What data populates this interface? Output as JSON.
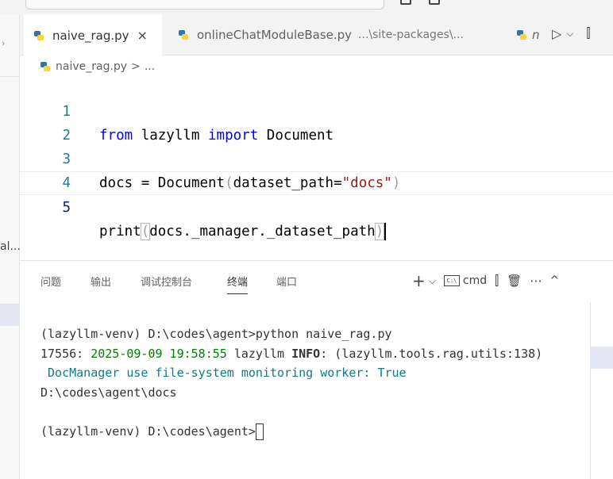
{
  "side": {
    "label": "al..."
  },
  "tabs": [
    {
      "label": "naive_rag.py",
      "close": "×"
    },
    {
      "label": "onlineChatModuleBase.py",
      "path": "...\\site-packages\\..."
    },
    {
      "label": "n"
    }
  ],
  "tab_actions": {
    "run": "▷",
    "dropdown": "⌵",
    "split": "⫿"
  },
  "breadcrumb": {
    "file": "naive_rag.py",
    "sep": ">",
    "more": "..."
  },
  "editor": {
    "line_numbers": [
      "1",
      "2",
      "3",
      "4",
      "5"
    ],
    "line1": {
      "kw1": "from",
      "mod": "lazyllm",
      "kw2": "import",
      "cls": "Document"
    },
    "line3": {
      "var": "docs",
      "eq": "=",
      "cls": "Document",
      "open": "(",
      "param": "dataset_path",
      "eq2": "=",
      "str": "\"docs\"",
      "close": ")"
    },
    "line5": {
      "fn": "print",
      "open": "(",
      "expr": "docs._manager._dataset_path",
      "close": ")"
    }
  },
  "panel": {
    "tabs": [
      "问题",
      "输出",
      "调试控制台",
      "终端",
      "端口"
    ],
    "active_tab": "终端",
    "actions": {
      "add": "+",
      "dropdown": "⌵",
      "shell": "cmd",
      "split": "⫿",
      "trash": "🗑",
      "more": "···",
      "collapse": "^"
    }
  },
  "terminal": {
    "line1": "(lazyllm-venv) D:\\codes\\agent>python naive_rag.py",
    "line2_pid": "17556: ",
    "line2_date": "2025-09-09 19:58:55",
    "line2_app": " lazyllm ",
    "line2_level": "INFO",
    "line2_rest": ": (lazyllm.tools.rag.utils:138)",
    "line3": " DocManager use file-system monitoring worker: True",
    "line4": "D:\\codes\\agent\\docs",
    "line6": "(lazyllm-venv) D:\\codes\\agent>"
  },
  "colors": {
    "keyword": "#0000ff",
    "class": "#267f99",
    "string": "#a31515",
    "identifier": "#001080",
    "function": "#795e26",
    "line_number": "#237893",
    "terminal_date": "#008000",
    "terminal_info": "#0e7c86"
  }
}
